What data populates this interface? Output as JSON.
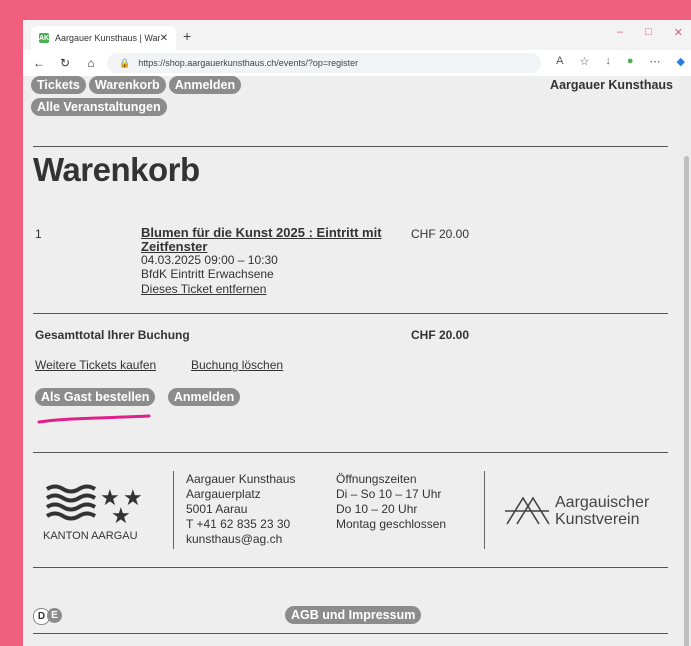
{
  "browser": {
    "tab_title": "Aargauer Kunsthaus | Warenkorb",
    "tab_favicon": "AK",
    "url": "https://shop.aargauerkunsthaus.ch/events/?op=register"
  },
  "nav": {
    "items": [
      "Tickets",
      "Warenkorb",
      "Anmelden"
    ],
    "all_events": "Alle Veranstaltungen",
    "brand": "Aargauer Kunsthaus"
  },
  "page": {
    "title": "Warenkorb"
  },
  "cart": {
    "item_qty": "1",
    "item_title_a": "Blumen für die Kunst 2025",
    "item_title_sep": " : ",
    "item_title_b": "Eintritt mit",
    "item_title_c": "Zeitfenster",
    "item_datetime": "04.03.2025 09:00 – 10:30",
    "item_category": "BfdK Eintritt Erwachsene",
    "remove_link": "Dieses Ticket entfernen",
    "item_price": "CHF 20.00",
    "total_label": "Gesamttotal Ihrer Buchung",
    "total_value": "CHF 20.00",
    "more_tickets": "Weitere Tickets kaufen",
    "delete_booking": "Buchung löschen",
    "guest_button": "Als Gast bestellen",
    "login_button": "Anmelden",
    "highlight_color": "#e0208a"
  },
  "footer": {
    "canton": "KANTON AARGAU",
    "address": [
      "Aargauer Kunsthaus",
      "Aargauerplatz",
      "5001 Aarau",
      "T +41 62 835 23 30",
      "kunsthaus@ag.ch"
    ],
    "hours": [
      "Öffnungszeiten",
      "Di – So 10 – 17 Uhr",
      "Do 10 – 20 Uhr",
      "Montag geschlossen"
    ],
    "partner": [
      "Aargauischer",
      "Kunstverein"
    ],
    "lang_d": "D",
    "lang_e": "E",
    "agb": "AGB und Impressum"
  }
}
